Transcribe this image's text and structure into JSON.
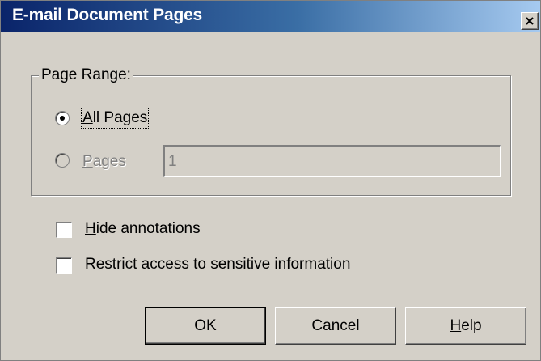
{
  "window": {
    "title": "E-mail Document Pages",
    "close_glyph": "✕"
  },
  "page_range": {
    "legend": "Page Range:",
    "all_pages": {
      "label_underlined": "A",
      "label_rest": "ll Pages",
      "selected": true
    },
    "pages": {
      "label_underlined": "P",
      "label_rest": "ages",
      "selected": false,
      "disabled": true,
      "value": "1"
    }
  },
  "options": {
    "hide_annotations": {
      "label_underlined": "H",
      "label_rest": "ide annotations",
      "checked": false
    },
    "restrict_access": {
      "label_underlined": "R",
      "label_rest": "estrict access to sensitive information",
      "checked": false
    }
  },
  "buttons": {
    "ok": "OK",
    "cancel": "Cancel",
    "help_underlined": "H",
    "help_rest": "elp"
  },
  "colors": {
    "title_gradient_start": "#0a246a",
    "title_gradient_end": "#a6caf0",
    "dialog_face": "#d4d0c8",
    "disabled_text": "#808080"
  }
}
